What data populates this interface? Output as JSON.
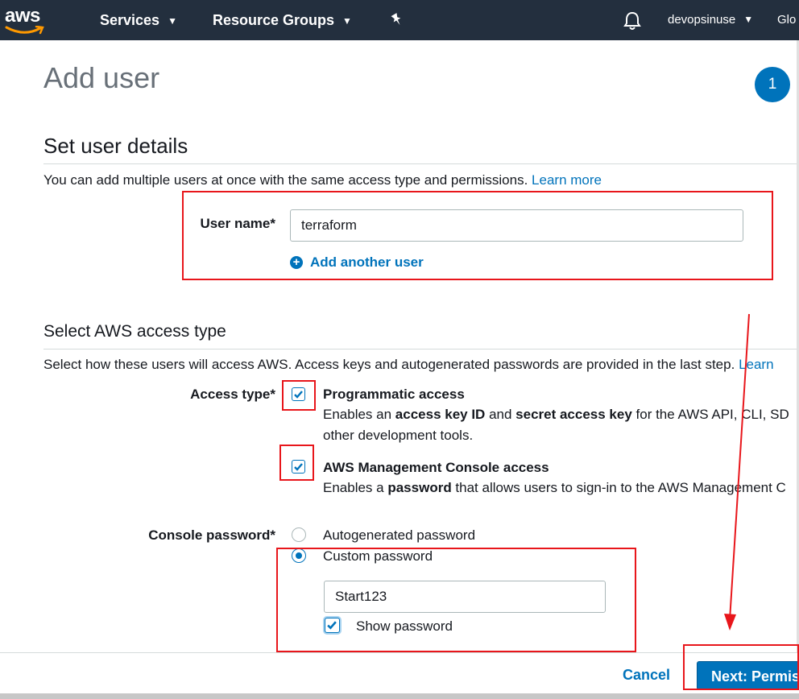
{
  "nav": {
    "logo": "aws",
    "services": "Services",
    "resource_groups": "Resource Groups",
    "pin_icon": "pin-icon",
    "bell_icon": "bell-icon",
    "user": "devopsinuse",
    "region": "Glo"
  },
  "page": {
    "title": "Add user",
    "step": "1"
  },
  "details": {
    "heading": "Set user details",
    "description": "You can add multiple users at once with the same access type and permissions.",
    "learn_more": "Learn more",
    "username_label": "User name*",
    "username_value": "terraform",
    "add_another": "Add another user"
  },
  "access": {
    "heading": "Select AWS access type",
    "description": "Select how these users will access AWS. Access keys and autogenerated passwords are provided in the last step.",
    "learn_more": "Learn",
    "access_type_label": "Access type*",
    "programmatic": {
      "title": "Programmatic access",
      "checked": true,
      "desc_pre": "Enables an ",
      "desc_b1": "access key ID",
      "desc_mid": " and ",
      "desc_b2": "secret access key",
      "desc_post": " for the AWS API, CLI, SD",
      "desc_line2": "other development tools."
    },
    "console": {
      "title": "AWS Management Console access",
      "checked": true,
      "desc_pre": "Enables a ",
      "desc_b1": "password",
      "desc_post": " that allows users to sign-in to the AWS Management C"
    },
    "password_label": "Console password*",
    "autogenerated": "Autogenerated password",
    "custom": "Custom password",
    "selected": "custom",
    "password_value": "Start123",
    "show_password": "Show password",
    "show_password_checked": true
  },
  "footer": {
    "cancel": "Cancel",
    "next": "Next: Permissions"
  },
  "colors": {
    "nav_bg": "#232f3e",
    "accent": "#0073bb",
    "annotation": "#e8161b"
  }
}
